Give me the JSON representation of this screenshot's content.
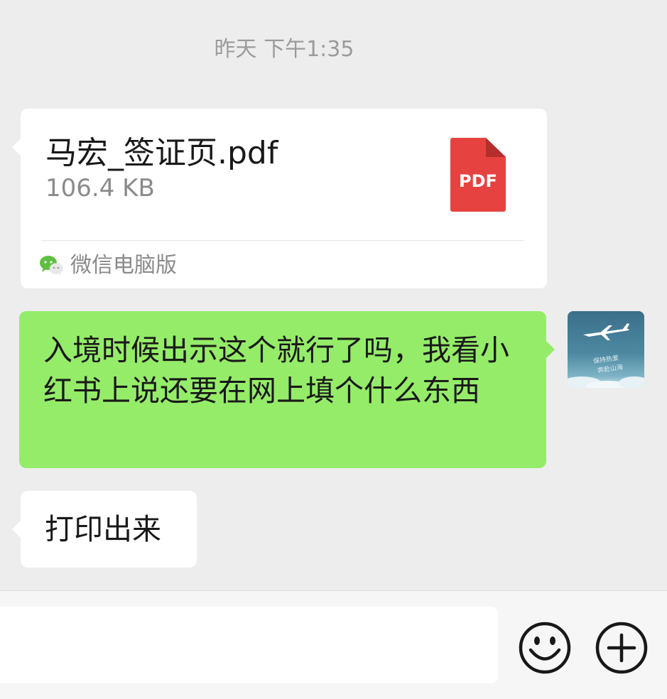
{
  "chat": {
    "timestamp": "昨天 下午1:35",
    "file_message": {
      "file_name": "马宏_签证页.pdf",
      "file_size": "106.4 KB",
      "file_type_label": "PDF",
      "file_icon": "pdf-icon",
      "source_icon": "wechat-icon",
      "source": "微信电脑版"
    },
    "sent_message": {
      "text": "入境时候出示这个就行了吗，我看小红书上说还要在网上填个什么东西",
      "avatar": "avatar",
      "avatar_caption": "保持热爱 奔赴山海"
    },
    "received_message": {
      "text": "打印出来"
    }
  },
  "input_bar": {
    "input_value": "",
    "emoji_icon": "emoji-smile-icon",
    "plus_icon": "plus-circle-icon"
  },
  "colors": {
    "background": "#ededed",
    "sent_bubble": "#95ec69",
    "received_bubble": "#ffffff",
    "pdf_red": "#e64340",
    "timestamp_gray": "#9b9b9b"
  }
}
